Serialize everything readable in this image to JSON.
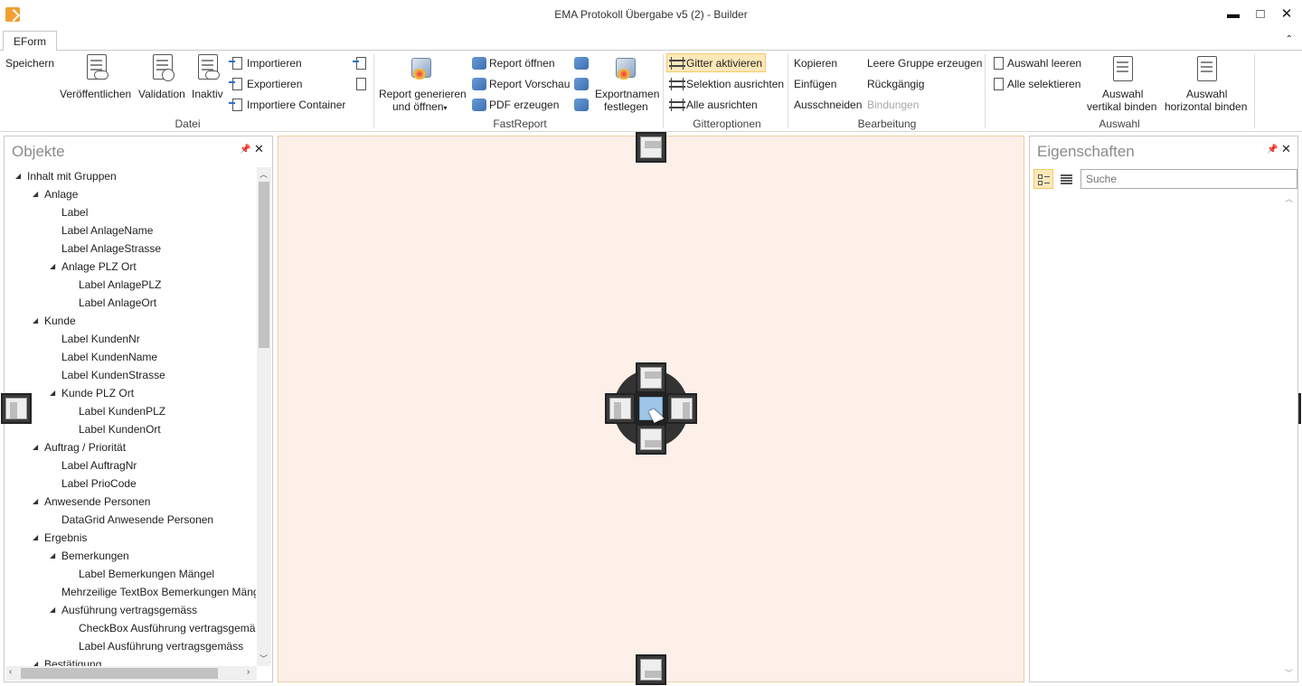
{
  "window": {
    "title": "EMA Protokoll Übergabe v5 (2) - Builder",
    "minimize": "▬",
    "maximize": "□",
    "close": "✕"
  },
  "tabs": {
    "active": "EForm",
    "collapse": "⌃"
  },
  "ribbon": {
    "datei": {
      "save": "Speichern",
      "publish": "Veröffentlichen",
      "validation": "Validation",
      "inactive": "Inaktiv",
      "import": "Importieren",
      "export": "Exportieren",
      "import_container": "Importiere Container",
      "group": "Datei"
    },
    "fastreport": {
      "generate_l1": "Report generieren",
      "generate_l2": "und öffnen",
      "open": "Report öffnen",
      "preview": "Report Vorschau",
      "pdf": "PDF erzeugen",
      "exportnames_l1": "Exportnamen",
      "exportnames_l2": "festlegen",
      "group": "FastReport"
    },
    "gitter": {
      "activate": "Gitter aktivieren",
      "align_selection": "Selektion ausrichten",
      "align_all": "Alle ausrichten",
      "group": "Gitteroptionen"
    },
    "bearbeitung": {
      "copy": "Kopieren",
      "paste": "Einfügen",
      "cut": "Ausschneiden",
      "empty_group": "Leere Gruppe erzeugen",
      "undo": "Rückgängig",
      "bindings": "Bindungen",
      "group": "Bearbeitung"
    },
    "auswahl": {
      "clear": "Auswahl leeren",
      "select_all": "Alle selektieren",
      "vertical_l1": "Auswahl",
      "vertical_l2": "vertikal binden",
      "horizontal_l1": "Auswahl",
      "horizontal_l2": "horizontal binden",
      "group": "Auswahl"
    }
  },
  "objects_panel": {
    "title": "Objekte",
    "tree": [
      {
        "label": "Inhalt mit Gruppen",
        "level": 0,
        "expanded": true
      },
      {
        "label": "Anlage",
        "level": 1,
        "expanded": true
      },
      {
        "label": "Label",
        "level": 2
      },
      {
        "label": "Label AnlageName",
        "level": 2
      },
      {
        "label": "Label AnlageStrasse",
        "level": 2
      },
      {
        "label": "Anlage PLZ Ort",
        "level": 2,
        "expanded": true
      },
      {
        "label": "Label AnlagePLZ",
        "level": 3
      },
      {
        "label": "Label AnlageOrt",
        "level": 3
      },
      {
        "label": "Kunde",
        "level": 1,
        "expanded": true
      },
      {
        "label": "Label KundenNr",
        "level": 2
      },
      {
        "label": "Label KundenName",
        "level": 2
      },
      {
        "label": "Label KundenStrasse",
        "level": 2
      },
      {
        "label": "Kunde PLZ Ort",
        "level": 2,
        "expanded": true
      },
      {
        "label": "Label KundenPLZ",
        "level": 3
      },
      {
        "label": "Label KundenOrt",
        "level": 3
      },
      {
        "label": "Auftrag / Priorität",
        "level": 1,
        "expanded": true
      },
      {
        "label": "Label AuftragNr",
        "level": 2
      },
      {
        "label": "Label PrioCode",
        "level": 2
      },
      {
        "label": "Anwesende Personen",
        "level": 1,
        "expanded": true
      },
      {
        "label": "DataGrid Anwesende Personen",
        "level": 2
      },
      {
        "label": "Ergebnis",
        "level": 1,
        "expanded": true
      },
      {
        "label": "Bemerkungen",
        "level": 2,
        "expanded": true
      },
      {
        "label": "Label Bemerkungen Mängel",
        "level": 3
      },
      {
        "label": "Mehrzeilige TextBox Bemerkungen Mäng",
        "level": 2
      },
      {
        "label": "Ausführung vertragsgemäss",
        "level": 2,
        "expanded": true
      },
      {
        "label": "CheckBox Ausführung vertragsgemäs",
        "level": 3
      },
      {
        "label": "Label Ausführung vertragsgemäss",
        "level": 3
      },
      {
        "label": "Bestätigung",
        "level": 1,
        "expanded": true
      }
    ]
  },
  "properties_panel": {
    "title": "Eigenschaften",
    "search_placeholder": "Suche"
  },
  "colors": {
    "canvas": "#fdf0e9",
    "canvas_border": "#f0cc9a",
    "highlight": "#fde8b8",
    "dock_center": "#9fc6e8"
  }
}
